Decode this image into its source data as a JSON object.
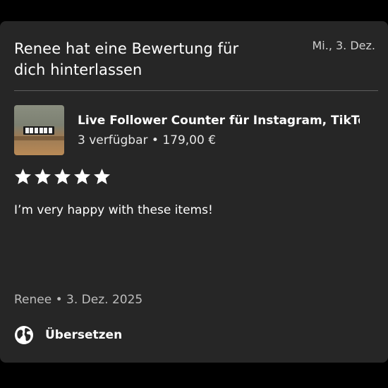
{
  "notification": {
    "title": "Renee hat eine Bewertung für dich hinterlassen",
    "date": "Mi., 3. Dez."
  },
  "product": {
    "name": "Live Follower Counter für Instagram, TikTo...",
    "availability": "3 verfügbar",
    "separator": "•",
    "price": "179,00 €",
    "thumbnail_icon": "product-photo"
  },
  "review": {
    "rating": 5,
    "max_rating": 5,
    "text": "I’m very happy with these items!",
    "author": "Renee",
    "date": "3. Dez. 2025"
  },
  "translate": {
    "label": "Übersetzen",
    "icon": "globe-icon"
  },
  "colors": {
    "background": "#000000",
    "card": "#262626",
    "text": "#ffffff",
    "muted": "#bdbdbd"
  }
}
